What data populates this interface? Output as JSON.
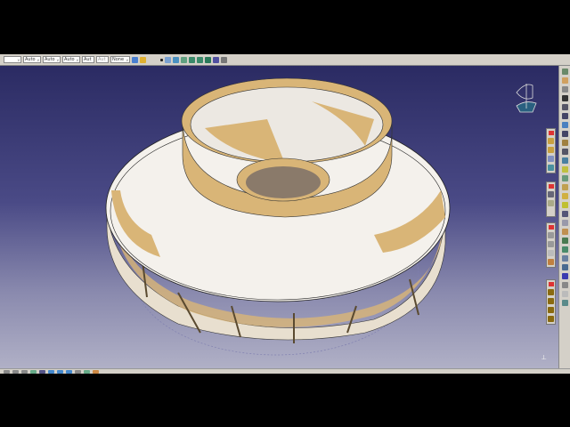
{
  "toolbar": {
    "selects": [
      {
        "name": "color",
        "value": ""
      },
      {
        "name": "transparency",
        "value": "Auto"
      },
      {
        "name": "line-thickness",
        "value": "Auto"
      },
      {
        "name": "linetype",
        "value": "Auto"
      },
      {
        "name": "point-symbol",
        "value": "Aut"
      },
      {
        "name": "render-style",
        "value": "Aut"
      },
      {
        "name": "layer",
        "value": "None"
      }
    ],
    "icons": [
      "format-painter-icon",
      "graphic-properties-icon",
      "point-icon",
      "pan-icon",
      "rotate-icon",
      "fly-icon",
      "zoom-in-icon",
      "zoom-out-icon",
      "normal-view-icon",
      "multi-view-icon",
      "hide-show-icon"
    ]
  },
  "colors": {
    "viewport_top": "#2b2b63",
    "viewport_bottom": "#b0b0c6",
    "part": "#d9b577",
    "toolbar": "#d4d0c8"
  }
}
